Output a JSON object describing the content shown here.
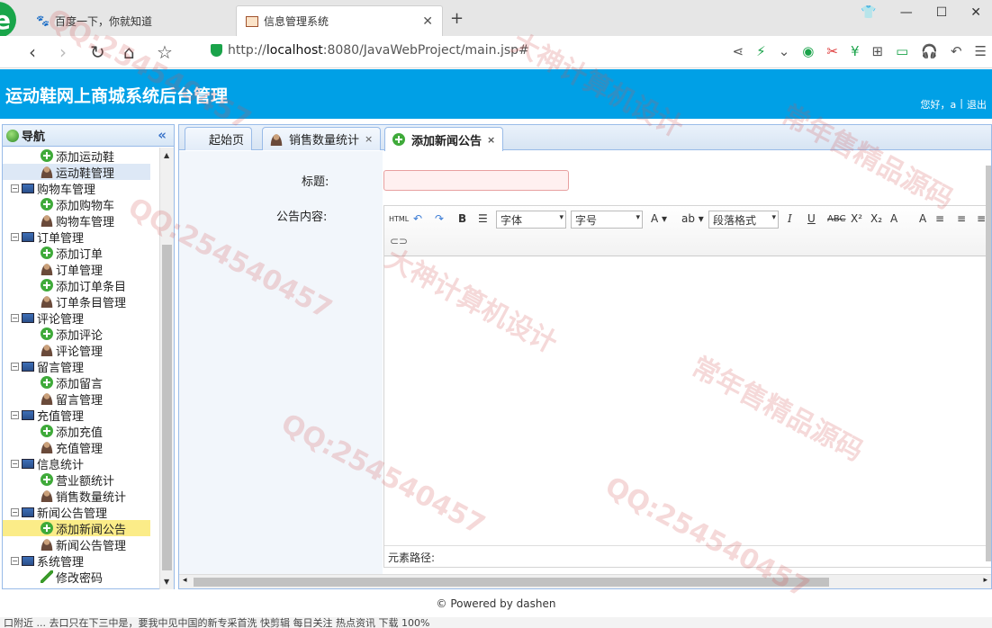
{
  "browser": {
    "tabs": [
      {
        "title": "百度一下，你就知道",
        "active": false
      },
      {
        "title": "信息管理系统",
        "active": true
      }
    ],
    "url_prefix": "http://",
    "url_host": "localhost",
    "url_rest": ":8080/JavaWebProject/main.jsp#"
  },
  "app": {
    "title": "运动鞋网上商城系统后台管理",
    "welcome": "您好，a",
    "separator": "|",
    "logout": "退出"
  },
  "nav": {
    "header": "导航",
    "collapse_icon": "«",
    "items": [
      {
        "label": "添加运动鞋",
        "icon": "add-icon"
      },
      {
        "label": "运动鞋管理",
        "icon": "user-icon"
      },
      {
        "label": "购物车管理",
        "icon": "monitor-icon",
        "parent": true
      },
      {
        "label": "添加购物车",
        "icon": "add-icon"
      },
      {
        "label": "购物车管理",
        "icon": "user-icon"
      },
      {
        "label": "订单管理",
        "icon": "monitor-icon",
        "parent": true
      },
      {
        "label": "添加订单",
        "icon": "add-icon"
      },
      {
        "label": "订单管理",
        "icon": "user-icon"
      },
      {
        "label": "添加订单条目",
        "icon": "add-icon"
      },
      {
        "label": "订单条目管理",
        "icon": "user-icon"
      },
      {
        "label": "评论管理",
        "icon": "monitor-icon",
        "parent": true
      },
      {
        "label": "添加评论",
        "icon": "add-icon"
      },
      {
        "label": "评论管理",
        "icon": "user-icon"
      },
      {
        "label": "留言管理",
        "icon": "monitor-icon",
        "parent": true
      },
      {
        "label": "添加留言",
        "icon": "add-icon"
      },
      {
        "label": "留言管理",
        "icon": "user-icon"
      },
      {
        "label": "充值管理",
        "icon": "monitor-icon",
        "parent": true
      },
      {
        "label": "添加充值",
        "icon": "add-icon"
      },
      {
        "label": "充值管理",
        "icon": "user-icon"
      },
      {
        "label": "信息统计",
        "icon": "monitor-icon",
        "parent": true
      },
      {
        "label": "营业额统计",
        "icon": "add-icon"
      },
      {
        "label": "销售数量统计",
        "icon": "user-icon"
      },
      {
        "label": "新闻公告管理",
        "icon": "monitor-icon",
        "parent": true
      },
      {
        "label": "添加新闻公告",
        "icon": "add-icon",
        "selected": true
      },
      {
        "label": "新闻公告管理",
        "icon": "user-icon"
      },
      {
        "label": "系统管理",
        "icon": "monitor-icon",
        "parent": true
      },
      {
        "label": "修改密码",
        "icon": "pen-icon"
      }
    ]
  },
  "main_tabs": [
    {
      "label": "起始页"
    },
    {
      "label": "销售数量统计",
      "close": "×"
    },
    {
      "label": "添加新闻公告",
      "close": "×"
    }
  ],
  "form": {
    "title_label": "标题:",
    "content_label": "公告内容:",
    "title_value": ""
  },
  "editor": {
    "html_btn": "HTML",
    "font_select": "字体",
    "size_select": "字号",
    "para_select": "段落格式",
    "path_label": "元素路径:"
  },
  "footer": "© Powered by dashen",
  "statusbar": "口附近    ... 去口只在下三中是，要我中见中国的新专采首洗    快剪辑    每日关注    热点资讯    下载    100%",
  "watermarks": [
    "QQ:254540457",
    "大神计算机设计",
    "常年售精品源码"
  ]
}
